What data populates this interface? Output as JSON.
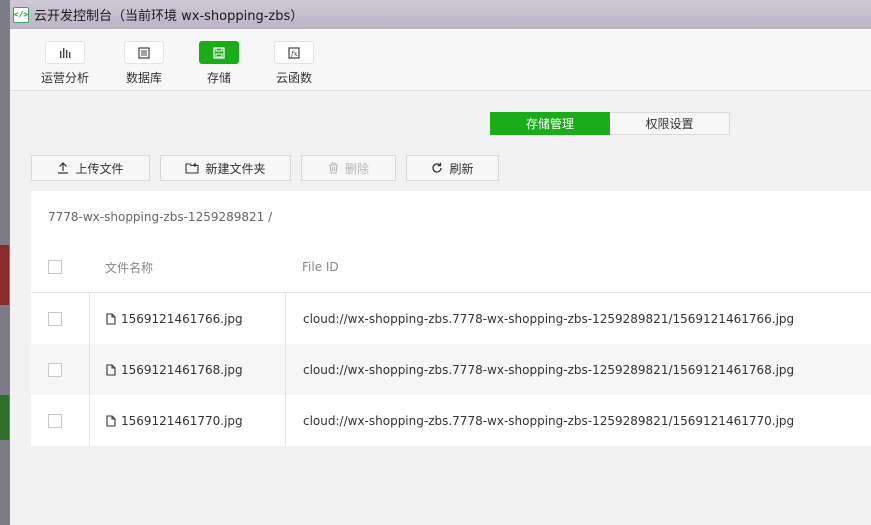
{
  "window": {
    "title": "云开发控制台（当前环境 wx-shopping-zbs）",
    "icon": "code-icon"
  },
  "toolbar": {
    "items": [
      {
        "label": "运营分析",
        "icon": "bar-chart-icon"
      },
      {
        "label": "数据库",
        "icon": "database-icon"
      },
      {
        "label": "存储",
        "icon": "save-icon",
        "active": true
      },
      {
        "label": "云函数",
        "icon": "function-icon"
      }
    ]
  },
  "tabs": {
    "manage": "存储管理",
    "permission": "权限设置"
  },
  "actions": {
    "upload": "上传文件",
    "new_folder": "新建文件夹",
    "delete": "删除",
    "refresh": "刷新"
  },
  "breadcrumb": "7778-wx-shopping-zbs-1259289821  /",
  "table": {
    "headers": {
      "name": "文件名称",
      "file_id": "File ID"
    },
    "rows": [
      {
        "name": "1569121461766.jpg",
        "file_id": "cloud://wx-shopping-zbs.7778-wx-shopping-zbs-1259289821/1569121461766.jpg"
      },
      {
        "name": "1569121461768.jpg",
        "file_id": "cloud://wx-shopping-zbs.7778-wx-shopping-zbs-1259289821/1569121461768.jpg"
      },
      {
        "name": "1569121461770.jpg",
        "file_id": "cloud://wx-shopping-zbs.7778-wx-shopping-zbs-1259289821/1569121461770.jpg"
      }
    ]
  },
  "colors": {
    "accent": "#1aad19"
  }
}
